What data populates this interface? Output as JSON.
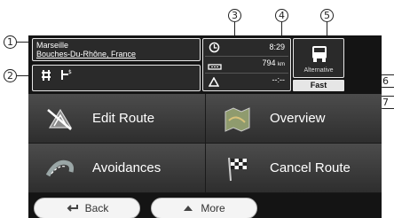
{
  "route": {
    "destination": "Marseille",
    "region": "Bouches-Du-Rhône, France"
  },
  "stats": {
    "arrival_time": "8:29",
    "distance": "794",
    "distance_unit": "km",
    "delay": "--:--"
  },
  "route_type": {
    "label": "Alternative",
    "mode": "Fast"
  },
  "menu": {
    "edit_route": "Edit Route",
    "overview": "Overview",
    "avoidances": "Avoidances",
    "cancel_route": "Cancel Route"
  },
  "bottom": {
    "back": "Back",
    "more": "More"
  },
  "callouts": {
    "c1": "1",
    "c2": "2",
    "c3": "3",
    "c4": "4",
    "c5": "5",
    "c6": "6",
    "c7": "7"
  }
}
